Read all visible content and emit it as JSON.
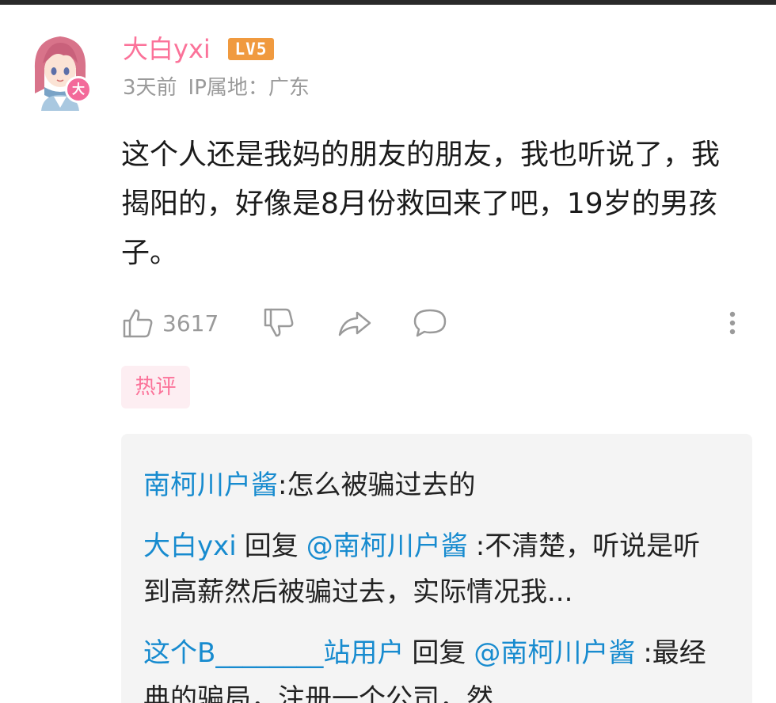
{
  "comment": {
    "username": "大白yxi",
    "level": "LV5",
    "avatar_badge": "大",
    "time_ago": "3天前",
    "ip_location": "IP属地：广东",
    "text": "这个人还是我妈的朋友的朋友，我也听说了，我揭阳的，好像是8月份救回来了吧，19岁的男孩子。",
    "likes": "3617",
    "tag": "热评"
  },
  "icons": {
    "like": "thumbs-up-icon",
    "dislike": "thumbs-down-icon",
    "share": "share-icon",
    "reply": "reply-icon",
    "more": "more-vertical-icon"
  },
  "replies": [
    {
      "user": "南柯川户酱",
      "text": ":怎么被骗过去的"
    },
    {
      "user": "大白yxi",
      "reply_word": "回复",
      "at": "@南柯川户酱",
      "text": ":不清楚，听说是听到高薪然后被骗过去，实际情况我..."
    },
    {
      "user": "这个B________站用户",
      "reply_word": "回复",
      "at": "@南柯川户酱",
      "text": ":最经典的骗局，注册一个公司，然"
    }
  ],
  "colors": {
    "username": "#fb7299",
    "level_badge": "#f09a3f",
    "meta": "#9a9a9a",
    "link_blue": "#178bcf",
    "reply_bg": "#f4f4f4",
    "tag_bg": "#fdeef2"
  }
}
